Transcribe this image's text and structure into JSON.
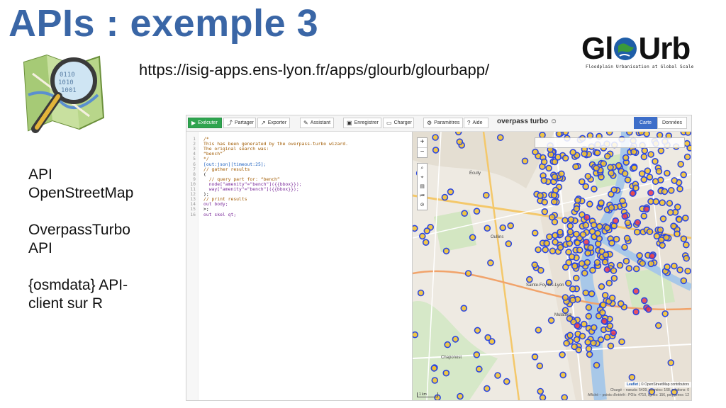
{
  "slide": {
    "title": "APIs : exemple 3",
    "url": "https://isig-apps.ens-lyon.fr/apps/glourb/glourbapp/",
    "logo_osm": "openstreetmap-magnifier-logo",
    "glourb": {
      "title": "Gl●Urb",
      "subtitle": "Floodplain Urbanisation at Global Scale"
    },
    "bullets": [
      [
        "API",
        "OpenStreetMap"
      ],
      [
        "OverpassTurbo",
        "API"
      ],
      [
        "{osmdata} API-",
        "client sur R"
      ]
    ]
  },
  "screenshot": {
    "toolbar": {
      "run": "Exécuter",
      "share": "Partager",
      "export": "Exporter",
      "wizard": "Assistant",
      "save": "Enregistrer",
      "load": "Charger",
      "settings": "Paramètres",
      "help": "Aide",
      "brand": "overpass turbo",
      "tab_map": "Carte",
      "tab_data": "Données"
    },
    "code": [
      {
        "n": "1",
        "t": "/*",
        "c": "c-com"
      },
      {
        "n": "2",
        "t": "This has been generated by the overpass-turbo wizard.",
        "c": "c-com"
      },
      {
        "n": "3",
        "t": "The original search was:",
        "c": "c-com"
      },
      {
        "n": "4",
        "t": "“bench”",
        "c": "c-com"
      },
      {
        "n": "5",
        "t": "*/",
        "c": "c-com"
      },
      {
        "n": "6",
        "t": "[out:json][timeout:25];",
        "c": "c-br"
      },
      {
        "n": "7",
        "t": "// gather results",
        "c": "c-com"
      },
      {
        "n": "8",
        "t": "(",
        "c": ""
      },
      {
        "n": "9",
        "t": "  // query part for: “bench”",
        "c": "c-com"
      },
      {
        "n": "10",
        "t": "  node[\"amenity\"=\"bench\"]({{bbox}});",
        "c": "c-kw"
      },
      {
        "n": "11",
        "t": "  way[\"amenity\"=\"bench\"]({{bbox}});",
        "c": "c-kw"
      },
      {
        "n": "12",
        "t": ");",
        "c": ""
      },
      {
        "n": "13",
        "t": "// print results",
        "c": "c-com"
      },
      {
        "n": "14",
        "t": "out body;",
        "c": "c-kw"
      },
      {
        "n": "15",
        "t": ">;",
        "c": ""
      },
      {
        "n": "16",
        "t": "out skel qt;",
        "c": "c-kw"
      }
    ],
    "map": {
      "attribution_leaflet": "Leaflet",
      "attribution_rest": "| © OpenStreetMap contributors",
      "stats_1": "Chargé – nœuds: 5439, chemins: 168, relations: 0",
      "stats_2": "Affiché – points d'intérêt : POIs: 4710, lignes: 156, polygones: 12",
      "scale_label": "1 km",
      "place_labels": [
        "Sainte-Foy-lès-Lyon",
        "Oullins",
        "Chaponost",
        "Écully",
        "Mulatière"
      ],
      "poi_color": "#f2c12e",
      "poi_stroke": "#2c47e0",
      "highlight_color": "#e8384f"
    }
  }
}
